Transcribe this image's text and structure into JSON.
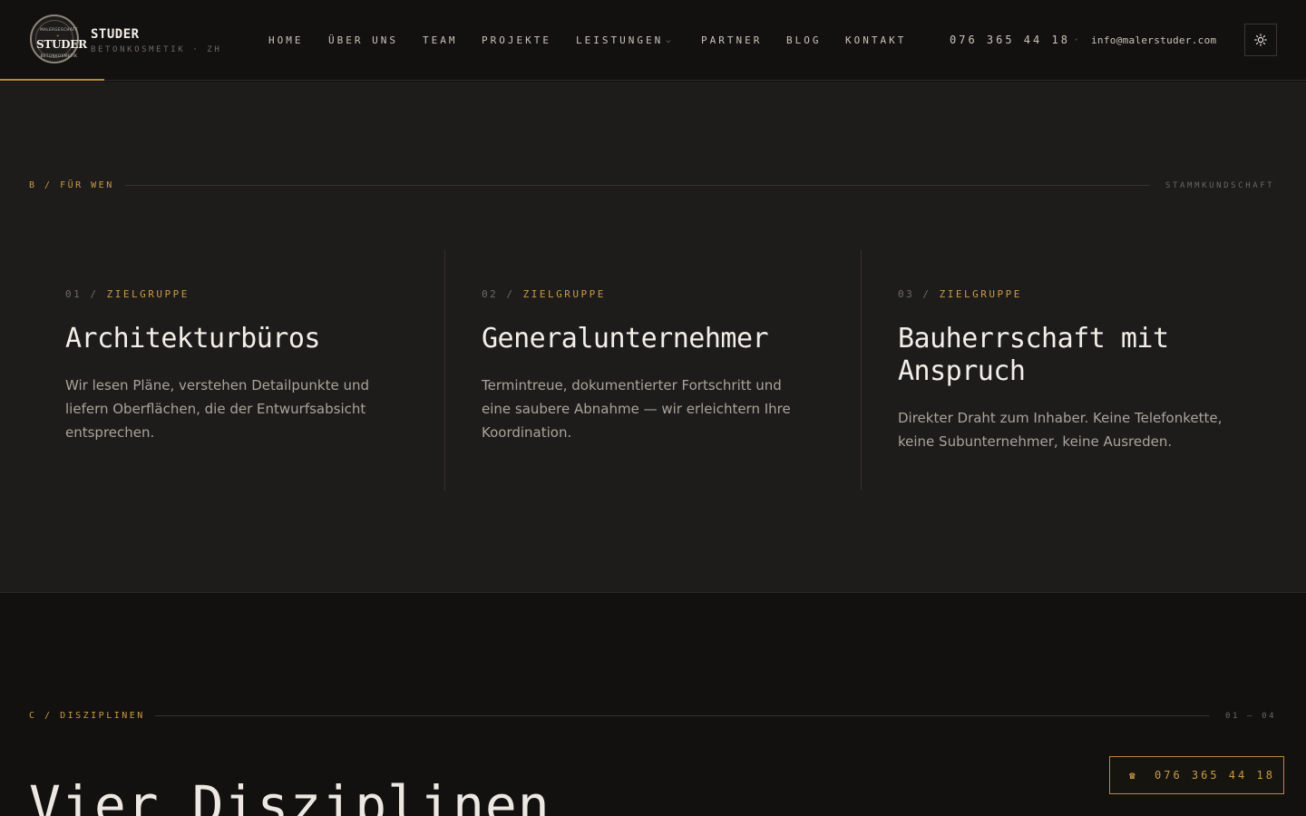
{
  "brand": {
    "name": "STUDER",
    "subtitle": "BETONKOSMETIK · ZH",
    "logo_text": "STUDER",
    "logo_arc_top": "MALERGESCHÄFT",
    "logo_arc_bottom": "BETONKOSMETIK"
  },
  "nav": {
    "items": [
      {
        "label": "HOME"
      },
      {
        "label": "ÜBER UNS"
      },
      {
        "label": "TEAM"
      },
      {
        "label": "PROJEKTE"
      },
      {
        "label": "LEISTUNGEN"
      },
      {
        "label": "PARTNER"
      },
      {
        "label": "BLOG"
      },
      {
        "label": "KONTAKT"
      }
    ],
    "phone": "076 365 44 18",
    "separator": "·",
    "email": "info@malerstuder.com",
    "theme_toggle_icon": "sun-icon"
  },
  "section_b": {
    "eyebrow": "B / FÜR WEN",
    "eyebrow_right": "STAMMKUNDSCHAFT",
    "columns": [
      {
        "num": "01",
        "sep": "/",
        "tag": "ZIELGRUPPE",
        "title": "Architekturbüros",
        "text": "Wir lesen Pläne, verstehen Detailpunkte und liefern Oberflächen, die der Entwurfsabsicht entsprechen."
      },
      {
        "num": "02",
        "sep": "/",
        "tag": "ZIELGRUPPE",
        "title": "Generalunternehmer",
        "text": "Termintreue, dokumentierter Fortschritt und eine saubere Abnahme — wir erleichtern Ihre Koordination."
      },
      {
        "num": "03",
        "sep": "/",
        "tag": "ZIELGRUPPE",
        "title": "Bauherrschaft mit Anspruch",
        "text": "Direkter Draht zum Inhaber. Keine Telefonkette, keine Subunternehmer, keine Ausreden."
      }
    ]
  },
  "section_c": {
    "eyebrow": "C / DISZIPLINEN",
    "eyebrow_right": "01 — 04",
    "heading": "Vier Disziplinen"
  },
  "call_button": {
    "icon": "☎",
    "label": "076 365 44 18"
  },
  "colors": {
    "accent": "#c99a45",
    "background_dark": "#121110",
    "background_section": "#1d1c1b",
    "text_primary": "#f2efe9",
    "text_muted": "#a9a49b"
  }
}
